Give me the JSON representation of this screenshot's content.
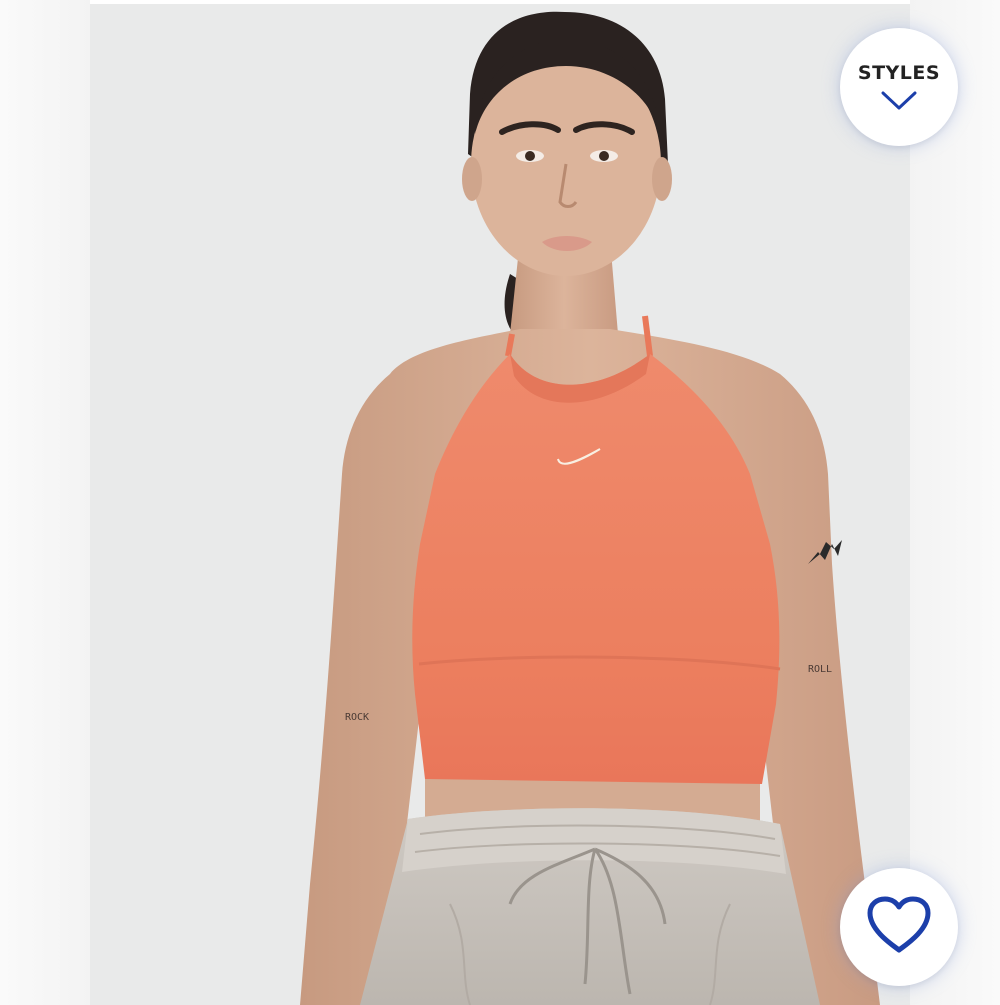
{
  "product": {
    "image_alt": "Woman wearing orange heathered halter crop top with grey drawstring pants",
    "accent_color": "#1c3faa",
    "top_color": "#ec8466",
    "pants_color": "#cac4bd"
  },
  "styles_button": {
    "label": "STYLES",
    "icon": "chevron-down-icon"
  },
  "favorite_button": {
    "icon": "heart-outline-icon"
  },
  "tattoos": {
    "left_arm": "ROCK",
    "right_arm": "ROLL"
  }
}
